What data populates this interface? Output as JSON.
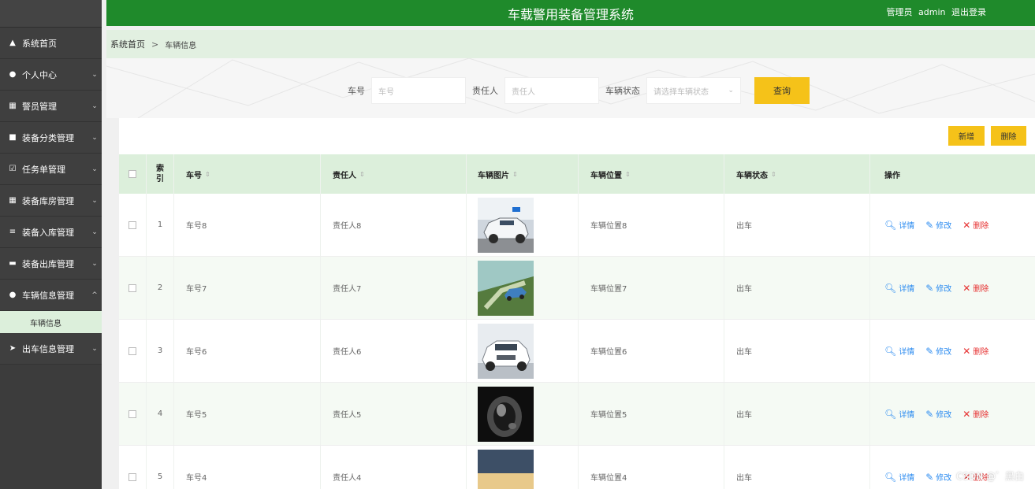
{
  "header": {
    "title": "车载警用装备管理系统",
    "user_role": "管理员",
    "user_name": "admin",
    "logout": "退出登录"
  },
  "sidebar": {
    "items": [
      {
        "label": "系统首页",
        "icon": "home-icon"
      },
      {
        "label": "个人中心",
        "icon": "user-icon"
      },
      {
        "label": "警员管理",
        "icon": "grid-icon"
      },
      {
        "label": "装备分类管理",
        "icon": "briefcase-icon"
      },
      {
        "label": "任务单管理",
        "icon": "checkbox-icon"
      },
      {
        "label": "装备库房管理",
        "icon": "grid-icon"
      },
      {
        "label": "装备入库管理",
        "icon": "list-icon"
      },
      {
        "label": "装备出库管理",
        "icon": "cylinder-icon"
      },
      {
        "label": "车辆信息管理",
        "icon": "pin-icon"
      },
      {
        "label": "出车信息管理",
        "icon": "send-icon"
      }
    ],
    "sub_item": "车辆信息"
  },
  "breadcrumb": {
    "home": "系统首页",
    "separator": ">",
    "current": "车辆信息"
  },
  "search": {
    "plate_label": "车号",
    "plate_placeholder": "车号",
    "person_label": "责任人",
    "person_placeholder": "责任人",
    "status_label": "车辆状态",
    "status_placeholder": "请选择车辆状态",
    "query_button": "查询"
  },
  "toolbar": {
    "add_button": "新增",
    "delete_button": "删除"
  },
  "table": {
    "headers": {
      "index": "索引",
      "plate": "车号",
      "person": "责任人",
      "image": "车辆图片",
      "location": "车辆位置",
      "status": "车辆状态",
      "ops": "操作"
    },
    "ops": {
      "detail": "详情",
      "edit": "修改",
      "delete": "删除"
    },
    "rows": [
      {
        "index": "1",
        "plate": "车号8",
        "person": "责任人8",
        "location": "车辆位置8",
        "status": "出车"
      },
      {
        "index": "2",
        "plate": "车号7",
        "person": "责任人7",
        "location": "车辆位置7",
        "status": "出车"
      },
      {
        "index": "3",
        "plate": "车号6",
        "person": "责任人6",
        "location": "车辆位置6",
        "status": "出车"
      },
      {
        "index": "4",
        "plate": "车号5",
        "person": "责任人5",
        "location": "车辆位置5",
        "status": "出车"
      },
      {
        "index": "5",
        "plate": "车号4",
        "person": "责任人4",
        "location": "车辆位置4",
        "status": "出车"
      }
    ]
  },
  "watermark": "CSDN @゛黑白",
  "colors": {
    "header_bg": "#1f8a2b",
    "sidebar_bg": "#3c3c3c",
    "accent_yellow": "#f5c219",
    "header_row_bg": "#dcefdb",
    "link_blue": "#2d8cf0",
    "delete_red": "#e63030"
  }
}
